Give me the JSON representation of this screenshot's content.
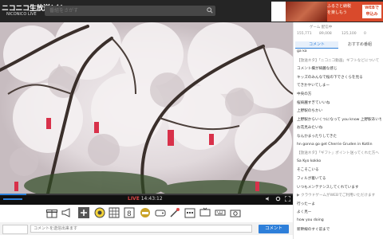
{
  "header": {
    "logo": "ニコニコ生放送(く)",
    "logo_sub": "NICONICO LIVE",
    "search_placeholder": "番組をさがす",
    "ad": {
      "line1": "ふるさと納税",
      "line2": "を楽しもう",
      "button": "WEBで 申込み"
    }
  },
  "player": {
    "live_label": "LIVE",
    "elapsed": "14:43:12",
    "progress": 0.09
  },
  "comment_bar": {
    "placeholder": "コメントを送信出来ます",
    "send_label": "コメント"
  },
  "sidebar": {
    "stats": [
      "ゲーム 配信中",
      "来場者",
      "コメント",
      "広告",
      "ギフト"
    ],
    "stat_values": [
      "155,771",
      "89,008",
      "125,100",
      "0"
    ],
    "tabs": [
      "コメント",
      "おすすめ番組"
    ],
    "comments": [
      {
        "text": "ga ka",
        "sys": false
      },
      {
        "text": "【放送ネタ】「ニコニコ動画」ギフトなどについて",
        "sys": true
      },
      {
        "text": "コメント欄が綺麗な感じ",
        "sys": false
      },
      {
        "text": "キッズのみんなで桜の下でさくらを見る",
        "sys": false
      },
      {
        "text": "てきかやいてしまー",
        "sys": false
      },
      {
        "text": "中央の方",
        "sys": false
      },
      {
        "text": "桜綺麗すぎていいね",
        "sys": false
      },
      {
        "text": "上野駅のちかい",
        "sys": false
      },
      {
        "text": "上野駅からいくつになって you know 上野駅あいちゃ",
        "sys": false
      },
      {
        "text": "お花見みたいね",
        "sys": false
      },
      {
        "text": "なんかまったりしてきた",
        "sys": false
      },
      {
        "text": "hn gonna go get Cherrie Gruden in Kotlin",
        "sys": false
      },
      {
        "text": "【放送ネタ】「ギフト」ポイント送ってくれた方へ",
        "sys": true
      },
      {
        "text": "Sa Kyo kokko",
        "sys": false
      },
      {
        "text": "そこそこいる",
        "sys": false
      },
      {
        "text": "フィルが着いてる",
        "sys": false
      },
      {
        "text": "いつもメンテナンスしてくれています",
        "sys": false
      },
      {
        "text": "▶ クラウドゲームがWEBでご利用いただけます",
        "sys": true
      },
      {
        "text": "行ったーよ",
        "sys": false
      },
      {
        "text": "よく見ー",
        "sys": false
      },
      {
        "text": "how you doing",
        "sys": false
      },
      {
        "text": "新幹線のすぐ前まで",
        "sys": false
      }
    ]
  },
  "icons": [
    "gift-icon",
    "megaphone-icon",
    "plus-icon",
    "bingo-icon",
    "map-icon",
    "number-icon",
    "game-icon",
    "pad-icon",
    "tv-icon",
    "keyboard-icon",
    "cam-icon"
  ]
}
